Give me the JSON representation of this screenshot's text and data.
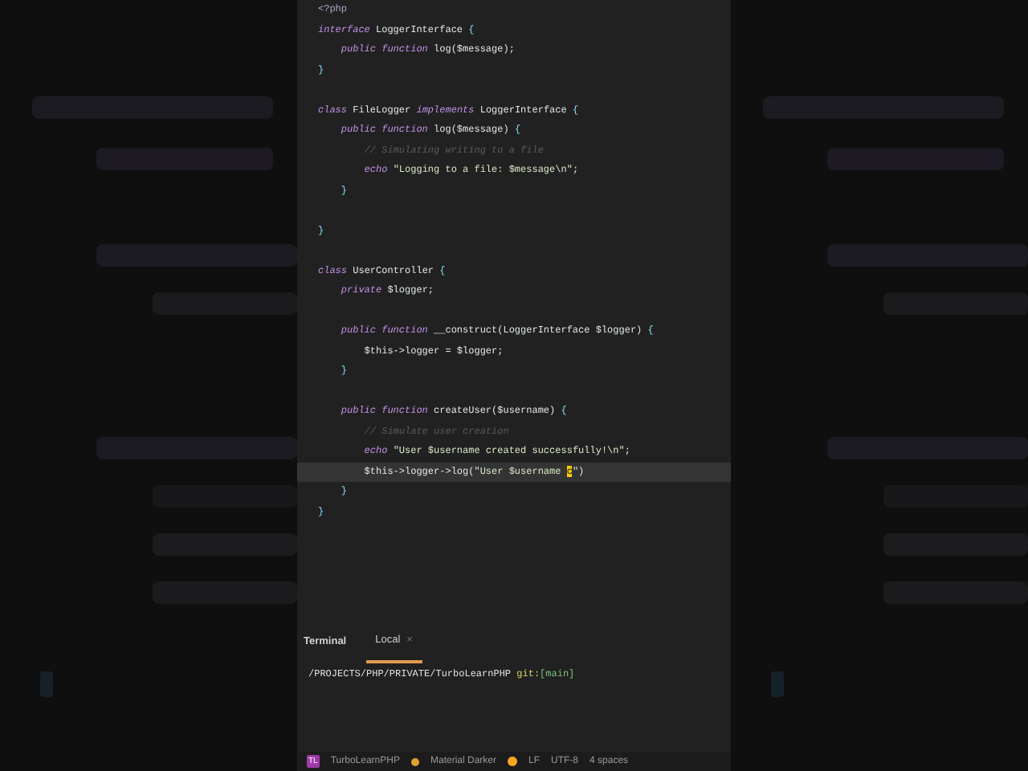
{
  "editor": {
    "lines": [
      {
        "current": false,
        "tokens": [
          {
            "kind": "tag",
            "text": "<?php"
          }
        ]
      },
      {
        "current": false,
        "tokens": [
          {
            "kind": "keyword",
            "text": "interface"
          },
          {
            "kind": "plain",
            "text": " LoggerInterface "
          },
          {
            "kind": "brace",
            "text": "{"
          }
        ]
      },
      {
        "current": false,
        "tokens": [
          {
            "kind": "keyword",
            "text": "    public function"
          },
          {
            "kind": "plain",
            "text": " log($message);"
          }
        ]
      },
      {
        "current": false,
        "tokens": [
          {
            "kind": "brace",
            "text": "}"
          }
        ]
      },
      {
        "current": false
      },
      {
        "current": false,
        "tokens": [
          {
            "kind": "keyword",
            "text": "class"
          },
          {
            "kind": "plain",
            "text": " FileLogger "
          },
          {
            "kind": "keyword",
            "text": "implements"
          },
          {
            "kind": "plain",
            "text": " LoggerInterface "
          },
          {
            "kind": "brace",
            "text": "{"
          }
        ]
      },
      {
        "current": false,
        "tokens": [
          {
            "kind": "keyword",
            "text": "    public function"
          },
          {
            "kind": "plain",
            "text": " log($message) "
          },
          {
            "kind": "brace",
            "text": "{"
          }
        ]
      },
      {
        "current": false,
        "tokens": [
          {
            "kind": "comment",
            "text": "        // Simulating writing to a file"
          }
        ]
      },
      {
        "current": false,
        "tokens": [
          {
            "kind": "keyword",
            "text": "        echo"
          },
          {
            "kind": "string",
            "text": " \"Logging to a file: $message\\n\""
          },
          {
            "kind": "plain",
            "text": ";"
          }
        ]
      },
      {
        "current": false,
        "tokens": [
          {
            "kind": "brace",
            "text": "    }"
          }
        ]
      },
      {
        "current": false
      },
      {
        "current": false,
        "tokens": [
          {
            "kind": "brace",
            "text": "}"
          }
        ]
      },
      {
        "current": false
      },
      {
        "current": false,
        "tokens": [
          {
            "kind": "keyword",
            "text": "class"
          },
          {
            "kind": "plain",
            "text": " UserController "
          },
          {
            "kind": "brace",
            "text": "{"
          }
        ]
      },
      {
        "current": false,
        "tokens": [
          {
            "kind": "keyword",
            "text": "    private"
          },
          {
            "kind": "plain",
            "text": " $logger;"
          }
        ]
      },
      {
        "current": false
      },
      {
        "current": false,
        "tokens": [
          {
            "kind": "keyword",
            "text": "    public function"
          },
          {
            "kind": "plain",
            "text": " __construct(LoggerInterface $logger) "
          },
          {
            "kind": "brace",
            "text": "{"
          }
        ]
      },
      {
        "current": false,
        "tokens": [
          {
            "kind": "plain",
            "text": "        $this->logger = $logger;"
          }
        ]
      },
      {
        "current": false,
        "tokens": [
          {
            "kind": "brace",
            "text": "    }"
          }
        ]
      },
      {
        "current": false
      },
      {
        "current": false,
        "tokens": [
          {
            "kind": "keyword",
            "text": "    public function"
          },
          {
            "kind": "plain",
            "text": " createUser($username) "
          },
          {
            "kind": "brace",
            "text": "{"
          }
        ]
      },
      {
        "current": false,
        "tokens": [
          {
            "kind": "comment",
            "text": "        // Simulate user creation"
          }
        ]
      },
      {
        "current": false,
        "tokens": [
          {
            "kind": "keyword",
            "text": "        echo"
          },
          {
            "kind": "string",
            "text": " \"User $username created successfully!\\n\""
          },
          {
            "kind": "plain",
            "text": ";"
          }
        ]
      },
      {
        "current": true,
        "tokens": [
          {
            "kind": "plain",
            "text": "        $this->logger->log("
          },
          {
            "kind": "string",
            "text": "\"User $username"
          },
          {
            "kind": "cursor",
            "text": "c"
          },
          {
            "kind": "string",
            "text": "\""
          },
          {
            "kind": "plain",
            "text": ")"
          }
        ]
      },
      {
        "current": false,
        "tokens": [
          {
            "kind": "brace",
            "text": "    }"
          }
        ]
      },
      {
        "current": false,
        "tokens": [
          {
            "kind": "brace",
            "text": "}"
          }
        ]
      }
    ]
  },
  "terminal": {
    "title": "Terminal",
    "tabs": [
      {
        "label": "Local",
        "close": "×",
        "selected": true
      }
    ],
    "path": "/PROJECTS/PHP/PRIVATE/TurboLearnPHP",
    "git": "git:",
    "branch": "[main]"
  },
  "status_bar": {
    "project": "TurboLearnPHP",
    "project_badge": "TL",
    "theme": "Material Darker",
    "line_ending": "LF",
    "encoding": "UTF-8",
    "indent": "4 spaces"
  }
}
